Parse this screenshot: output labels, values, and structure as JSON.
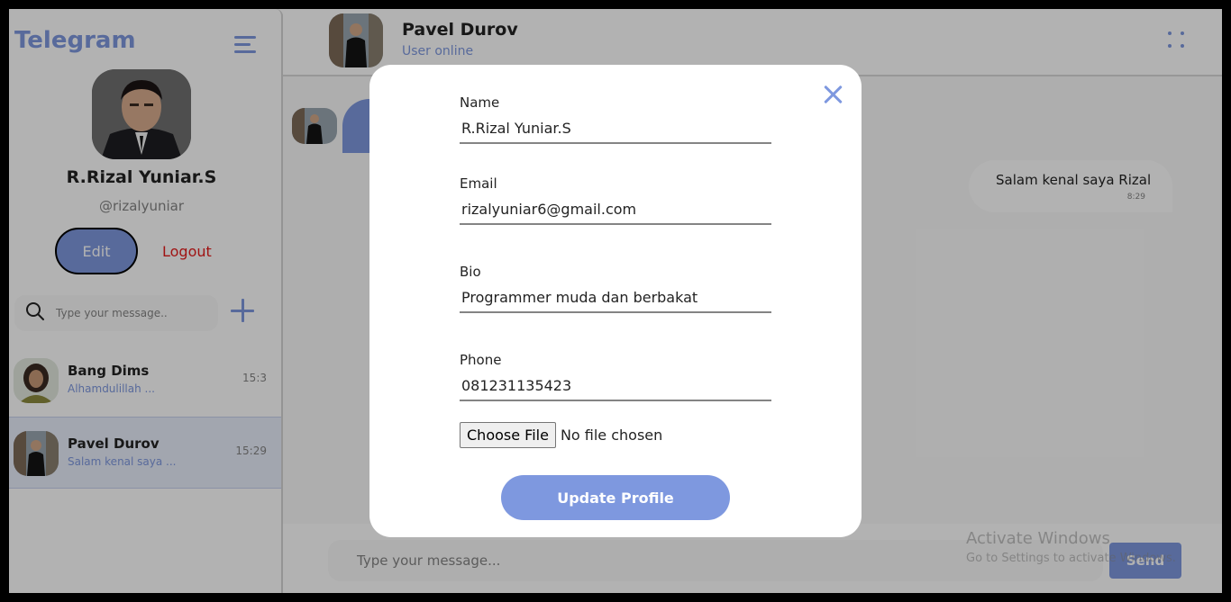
{
  "sidebar": {
    "brand": "Telegram",
    "profile": {
      "name": "R.Rizal Yuniar.S",
      "handle": "@rizalyuniar",
      "edit_label": "Edit",
      "logout_label": "Logout"
    },
    "search": {
      "placeholder": "Type your message.."
    },
    "chats": [
      {
        "name": "Bang Dims",
        "snippet": "Alhamdulillah ...",
        "time": "15:3"
      },
      {
        "name": "Pavel Durov",
        "snippet": "Salam kenal saya ...",
        "time": "15:29"
      }
    ]
  },
  "chat": {
    "contact_name": "Pavel Durov",
    "status": "User online",
    "messages": [
      {
        "text": "Salam kenal saya Rizal",
        "time": "8:29"
      }
    ],
    "composer": {
      "placeholder": "Type your message...",
      "send_label": "Send"
    }
  },
  "watermark": {
    "line1": "Activate Windows",
    "line2": "Go to Settings to activate Windows."
  },
  "modal": {
    "fields": [
      {
        "label": "Name",
        "value": "R.Rizal Yuniar.S"
      },
      {
        "label": "Email",
        "value": "rizalyuniar6@gmail.com"
      },
      {
        "label": "Bio",
        "value": "Programmer muda dan berbakat"
      },
      {
        "label": "Phone",
        "value": "081231135423"
      }
    ],
    "file_button": "Choose File",
    "file_status": "No file chosen",
    "submit_label": "Update Profile"
  },
  "colors": {
    "accent": "#7e98df",
    "danger": "#e51c1c",
    "text": "#232323",
    "muted": "#848484"
  },
  "icons": [
    "menu-icon",
    "search-icon",
    "plus-icon",
    "more-dots-icon",
    "close-icon"
  ]
}
